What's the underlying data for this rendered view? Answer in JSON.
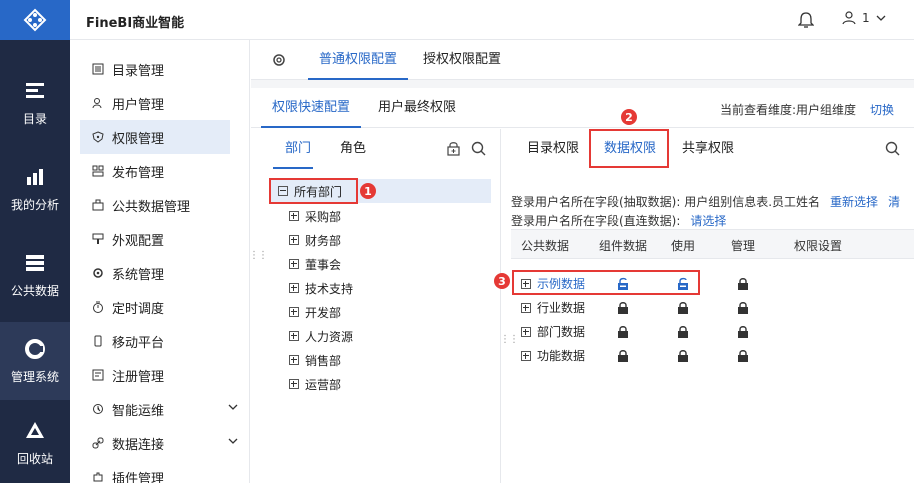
{
  "app": {
    "title": "FineBI商业智能"
  },
  "user": {
    "name": "1"
  },
  "rail": [
    {
      "label": "目录",
      "icon": "catalog-icon"
    },
    {
      "label": "我的分析",
      "icon": "analysis-icon"
    },
    {
      "label": "公共数据",
      "icon": "public-data-icon"
    },
    {
      "label": "管理系统",
      "icon": "management-icon",
      "active": true
    },
    {
      "label": "回收站",
      "icon": "recycle-icon"
    }
  ],
  "sidebar": {
    "items": [
      {
        "label": "目录管理",
        "icon": "list-icon"
      },
      {
        "label": "用户管理",
        "icon": "user-icon"
      },
      {
        "label": "权限管理",
        "icon": "shield-icon",
        "active": true
      },
      {
        "label": "发布管理",
        "icon": "publish-icon"
      },
      {
        "label": "公共数据管理",
        "icon": "box-icon"
      },
      {
        "label": "外观配置",
        "icon": "brush-icon"
      },
      {
        "label": "系统管理",
        "icon": "gear-icon"
      },
      {
        "label": "定时调度",
        "icon": "timer-icon"
      },
      {
        "label": "移动平台",
        "icon": "phone-icon"
      },
      {
        "label": "注册管理",
        "icon": "register-icon"
      },
      {
        "label": "智能运维",
        "icon": "ops-icon",
        "expandable": true
      },
      {
        "label": "数据连接",
        "icon": "link-icon",
        "expandable": true
      },
      {
        "label": "插件管理",
        "icon": "plugin-icon"
      }
    ]
  },
  "tabs_top": {
    "normal": "普通权限配置",
    "grant": "授权权限配置"
  },
  "tabs_second": {
    "quick": "权限快速配置",
    "final": "用户最终权限"
  },
  "dimension": {
    "label": "当前查看维度:用户组维度",
    "switch": "切换"
  },
  "left_panel": {
    "tab_dept": "部门",
    "tab_role": "角色",
    "root": "所有部门",
    "children": [
      "采购部",
      "财务部",
      "董事会",
      "技术支持",
      "开发部",
      "人力资源",
      "销售部",
      "运营部"
    ]
  },
  "right_panel": {
    "tab_catalog": "目录权限",
    "tab_data": "数据权限",
    "tab_share": "共享权限",
    "info1_text": "登录用户名所在字段(抽取数据): 用户组别信息表.员工姓名",
    "info1_link": "重新选择",
    "info1_link2": "清",
    "info2_text": "登录用户名所在字段(直连数据):",
    "info2_link": "请选择",
    "headers": {
      "public_data": "公共数据",
      "component_data": "组件数据",
      "use": "使用",
      "manage": "管理",
      "perm_setting": "权限设置"
    },
    "rows": [
      {
        "name": "示例数据",
        "highlight": true
      },
      {
        "name": "行业数据"
      },
      {
        "name": "部门数据"
      },
      {
        "name": "功能数据"
      }
    ]
  },
  "annotations": {
    "one": "1",
    "two": "2",
    "three": "3"
  },
  "colors": {
    "accent": "#2868c7",
    "rail_bg": "#1f2a44",
    "marker": "#e53935"
  }
}
